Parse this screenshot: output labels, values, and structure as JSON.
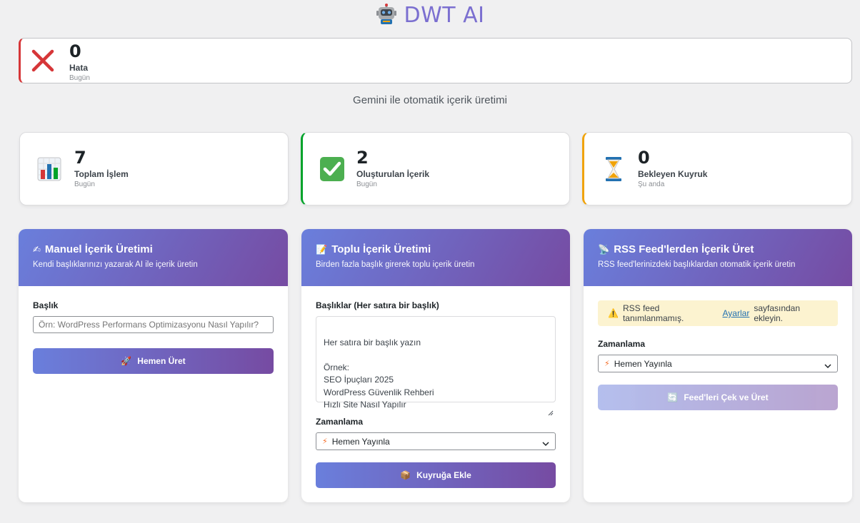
{
  "header": {
    "title": "DWT AI",
    "subtitle": "Gemini ile otomatik içerik üretimi"
  },
  "error_stat": {
    "value": "0",
    "label": "Hata",
    "sub": "Bugün",
    "color": "#d63638"
  },
  "stats": [
    {
      "value": "7",
      "label": "Toplam İşlem",
      "sub": "Bugün",
      "icon": "bar-chart-icon"
    },
    {
      "value": "2",
      "label": "Oluşturulan İçerik",
      "sub": "Bugün",
      "icon": "check-icon",
      "color": "#00a32a"
    },
    {
      "value": "0",
      "label": "Bekleyen Kuyruk",
      "sub": "Şu anda",
      "icon": "hourglass-icon",
      "color": "#f0a30a"
    }
  ],
  "panels": {
    "manual": {
      "title": "Manuel İçerik Üretimi",
      "desc": "Kendi başlıklarınızı yazarak AI ile içerik üretin",
      "field_label": "Başlık",
      "input_placeholder": "Örn: WordPress Performans Optimizasyonu Nasıl Yapılır?",
      "button": "Hemen Üret"
    },
    "bulk": {
      "title": "Toplu İçerik Üretimi",
      "desc": "Birden fazla başlık girerek toplu içerik üretin",
      "field_label": "Başlıklar (Her satıra bir başlık)",
      "textarea_placeholder": "Her satıra bir başlık yazın\n\nÖrnek:\nSEO İpuçları 2025\nWordPress Güvenlik Rehberi\nHızlı Site Nasıl Yapılır",
      "schedule_label": "Zamanlama",
      "schedule_value": "Hemen Yayınla",
      "button": "Kuyruğa Ekle"
    },
    "rss": {
      "title": "RSS Feed'lerden İçerik Üret",
      "desc": "RSS feed'lerinizdeki başlıklardan otomatik içerik üretin",
      "notice_before": "RSS feed tanımlanmamış.",
      "notice_link": "Ayarlar",
      "notice_after": "sayfasından ekleyin.",
      "schedule_label": "Zamanlama",
      "schedule_value": "Hemen Yayınla",
      "button": "Feed'leri Çek ve Üret"
    }
  },
  "colors": {
    "accent_start": "#6a7fdc",
    "accent_end": "#764ba2",
    "title": "#7b6fd0"
  }
}
